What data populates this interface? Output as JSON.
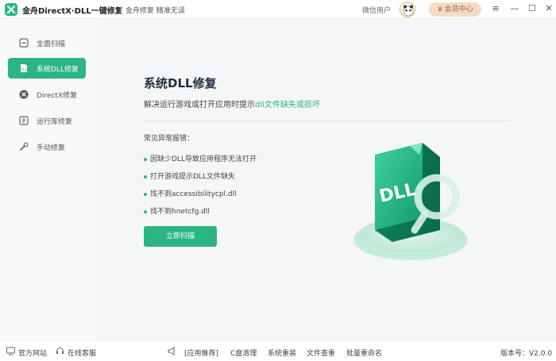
{
  "app": {
    "title": "金舟DirectX·DLL一键修复",
    "slogan": "金舟修复 精准无误",
    "user_label": "微信用户",
    "vip_label": "会员中心",
    "accent_color": "#2bb583"
  },
  "window_controls": {
    "menu_icon": "≡",
    "minimize_icon": "—",
    "maximize_icon": "☐",
    "close_icon": "✕"
  },
  "sidebar": {
    "items": [
      {
        "label": "全面扫描",
        "icon": "scan-icon",
        "active": false
      },
      {
        "label": "系统DLL修复",
        "icon": "dll-icon",
        "active": true
      },
      {
        "label": "DirectX修复",
        "icon": "directx-icon",
        "active": false
      },
      {
        "label": "运行库修复",
        "icon": "runtime-icon",
        "active": false
      },
      {
        "label": "手动修复",
        "icon": "wrench-icon",
        "active": false
      }
    ]
  },
  "main": {
    "title": "系统DLL修复",
    "subtitle_prefix": "解决运行游戏或打开应用时提示",
    "subtitle_highlight": "dll文件缺失或损坏",
    "errors_heading": "常见异常报错：",
    "errors": [
      "因缺少DLL导致应用程序无法打开",
      "打开游戏提示DLL文件缺失",
      "找不到accessibilitycpl.dll",
      "找不到hnetcfg.dll"
    ],
    "scan_button": "立即扫描",
    "illustration_text": "DLL"
  },
  "footer": {
    "website": "官方网站",
    "support": "在线客服",
    "recommend": "[应用推荐]",
    "links": [
      "C盘清理",
      "系统重装",
      "文件查重",
      "批量重命名"
    ],
    "version": "版本号：V2.0.0"
  }
}
